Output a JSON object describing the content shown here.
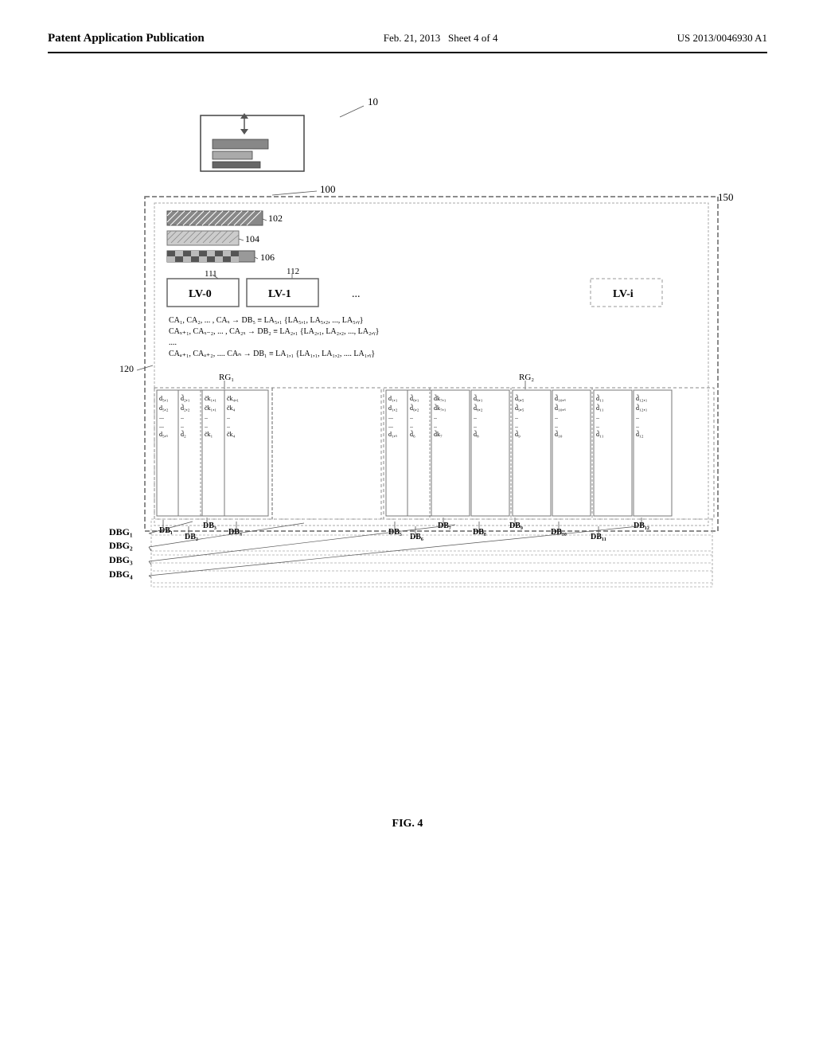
{
  "header": {
    "left": "Patent Application Publication",
    "center_line1": "Feb. 21, 2013",
    "center_line2": "Sheet 4 of 4",
    "right": "US 2013/0046930 A1"
  },
  "figure": {
    "label": "FIG. 4",
    "elements": {
      "ref_10": "10",
      "ref_100": "100",
      "ref_102": "102",
      "ref_104": "104",
      "ref_106": "106",
      "ref_111": "111",
      "ref_112": "112",
      "ref_120": "120",
      "ref_150": "150",
      "lv0": "LV-0",
      "lv1": "LV-1",
      "lvi": "LV-i",
      "ellipsis": "...",
      "rg1": "RG₁",
      "rg2": "RG₂",
      "formula1": "CA₁, CA₂, ...  , CAₓ → DB₅ ≡ LA₅,₁ {LA₅,₁, LA₅,₂, ..., LA₅,ᵧ}",
      "formula2": "CAₓ₊₁, CAₓ₋₂, ... , CA₂ₓ → DB₂ ≡ LA₂,₁ {LA₂,₁, LA₂,₂, ..., LA₂,ᵧ}",
      "formula3": "....",
      "formula4": "CAₐ₊₁, CAₐ₊₂, .... CAₙ → DB₁ ≡ LA₁,₁ {LA₁,₁, LA₁,₂, .... LA₁,ᵧ}",
      "dbg1": "DBG₁",
      "dbg2": "DBG₂",
      "dbg3": "DBG₃",
      "dbg4": "DBG₄",
      "db_labels": [
        "DB₁",
        "DB₂",
        "DB₃",
        "DB₄",
        "DB₅",
        "DB₆",
        "DB₇",
        "DB₈",
        "DB₉",
        "DB₁₀",
        "DB₁₁",
        "DB₁₂"
      ]
    }
  }
}
